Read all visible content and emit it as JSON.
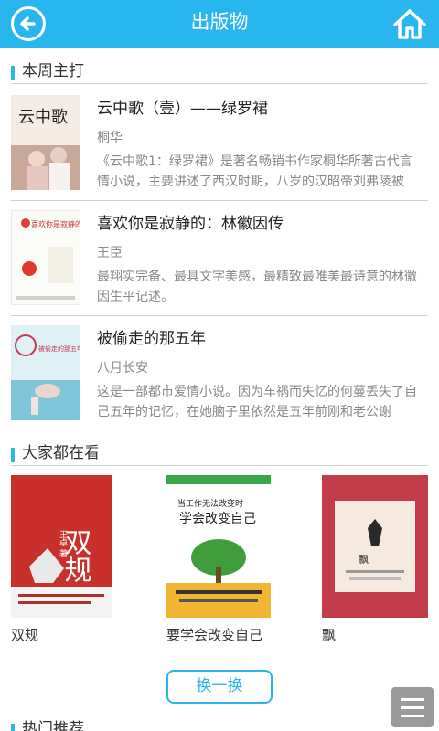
{
  "header": {
    "title": "出版物",
    "back_icon": "back-arrow-icon",
    "home_icon": "home-icon",
    "accent": "#29b6ef"
  },
  "weekly": {
    "heading": "本周主打",
    "books": [
      {
        "title": "云中歌（壹）——绿罗裙",
        "author": "桐华",
        "desc": "《云中歌1：绿罗裙》是著名畅销书作家桐华所著古代言情小说，主要讲述了西汉时期，八岁的汉昭帝刘弗陵被",
        "cover_text": "云中歌"
      },
      {
        "title": "喜欢你是寂静的：林徽因传",
        "author": "王臣",
        "desc": "最翔实完备、最具文字美感，最精致最唯美最诗意的林徽因生平记述。",
        "cover_text": "喜欢你是寂静的"
      },
      {
        "title": "被偷走的那五年",
        "author": "八月长安",
        "desc": "这是一部都市爱情小说。因为车祸而失忆的何蔓丢失了自己五年的记忆，在她脑子里依然是五年前刚和老公谢",
        "cover_text": "被偷走的那五年"
      }
    ]
  },
  "popular": {
    "heading": "大家都在看",
    "books": [
      {
        "title": "双规",
        "cover_text": "双规",
        "cover_author": "王卓 著"
      },
      {
        "title": "要学会改变自己",
        "cover_text": "学会改变自己",
        "cover_top": "当工作无法改变时"
      },
      {
        "title": "飘",
        "cover_text": "飘"
      }
    ],
    "swap_label": "换一换"
  },
  "hot": {
    "heading": "热门推荐"
  },
  "menu_icon": "menu-icon"
}
